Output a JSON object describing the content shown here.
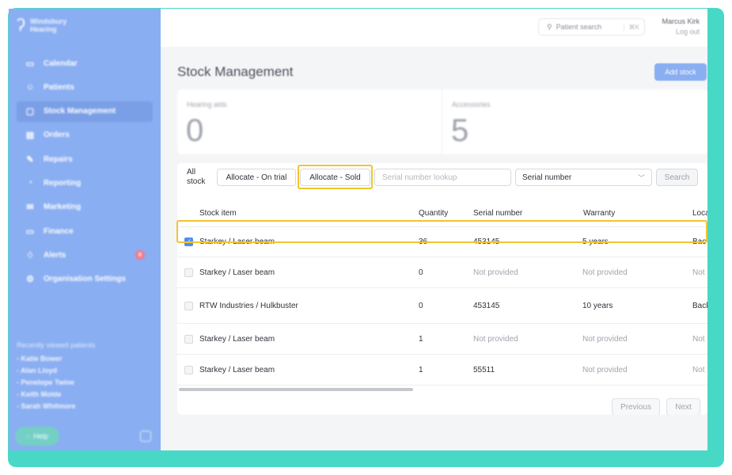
{
  "brand": {
    "name_line1": "Windsbury",
    "name_line2": "Hearing"
  },
  "sidebar": {
    "items": [
      {
        "icon": "▭",
        "label": "Calendar",
        "active": false
      },
      {
        "icon": "☺",
        "label": "Patients",
        "active": false
      },
      {
        "icon": "▢",
        "label": "Stock Management",
        "active": true
      },
      {
        "icon": "▤",
        "label": "Orders",
        "active": false
      },
      {
        "icon": "✎",
        "label": "Repairs",
        "active": false
      },
      {
        "icon": "◔",
        "label": "Reporting",
        "active": false
      },
      {
        "icon": "✉",
        "label": "Marketing",
        "active": false
      },
      {
        "icon": "▭",
        "label": "Finance",
        "active": false
      },
      {
        "icon": "♢",
        "label": "Alerts",
        "active": false,
        "badge": "6"
      },
      {
        "icon": "⚙",
        "label": "Organisation Settings",
        "active": false
      }
    ],
    "recent_title": "Recently viewed patients",
    "recent": [
      "- Katie Bower",
      "- Alan Lloyd",
      "- Penelope Twine",
      "- Keith Molde",
      "- Sarah Whitmore"
    ],
    "help_label": "Help"
  },
  "topbar": {
    "search_placeholder": "Patient search",
    "shortcut": "⌘K",
    "user_name": "Marcus Kirk",
    "logout": "Log out"
  },
  "page": {
    "title": "Stock Management",
    "add_button": "Add stock"
  },
  "stats": {
    "hearing_aids_label": "Hearing aids",
    "hearing_aids_value": "0",
    "accessories_label": "Accessories",
    "accessories_value": "5"
  },
  "filters": {
    "all_label_1": "All",
    "all_label_2": "stock",
    "on_trial": "Allocate - On trial",
    "sold": "Allocate - Sold",
    "lookup_placeholder": "Serial number lookup",
    "select_value": "Serial number",
    "search": "Search"
  },
  "table": {
    "headers": [
      "Stock item",
      "Quantity",
      "Serial number",
      "Warranty",
      "Loca"
    ],
    "rows": [
      {
        "item": "Starkey / Laser beam",
        "qty": "36",
        "serial": "453145",
        "warranty": "5 years",
        "loc": "Bac",
        "checked": true
      },
      {
        "item": "Starkey / Laser beam",
        "qty": "0",
        "serial": "Not provided",
        "warranty": "Not provided",
        "loc": "Not",
        "checked": false
      },
      {
        "item": "RTW Industries / Hulkbuster",
        "qty": "0",
        "serial": "453145",
        "warranty": "10 years",
        "loc": "Back",
        "checked": false
      },
      {
        "item": "Starkey / Laser beam",
        "qty": "1",
        "serial": "Not provided",
        "warranty": "Not provided",
        "loc": "Not",
        "checked": false
      },
      {
        "item": "Starkey / Laser beam",
        "qty": "1",
        "serial": "55511",
        "warranty": "Not provided",
        "loc": "Not",
        "checked": false
      }
    ]
  },
  "pager": {
    "previous": "Previous",
    "next": "Next"
  },
  "colors": {
    "frame": "#48d8c6",
    "sidebar": "#8aaef2",
    "highlight": "#f0c530",
    "checkbox": "#4f8df0"
  }
}
